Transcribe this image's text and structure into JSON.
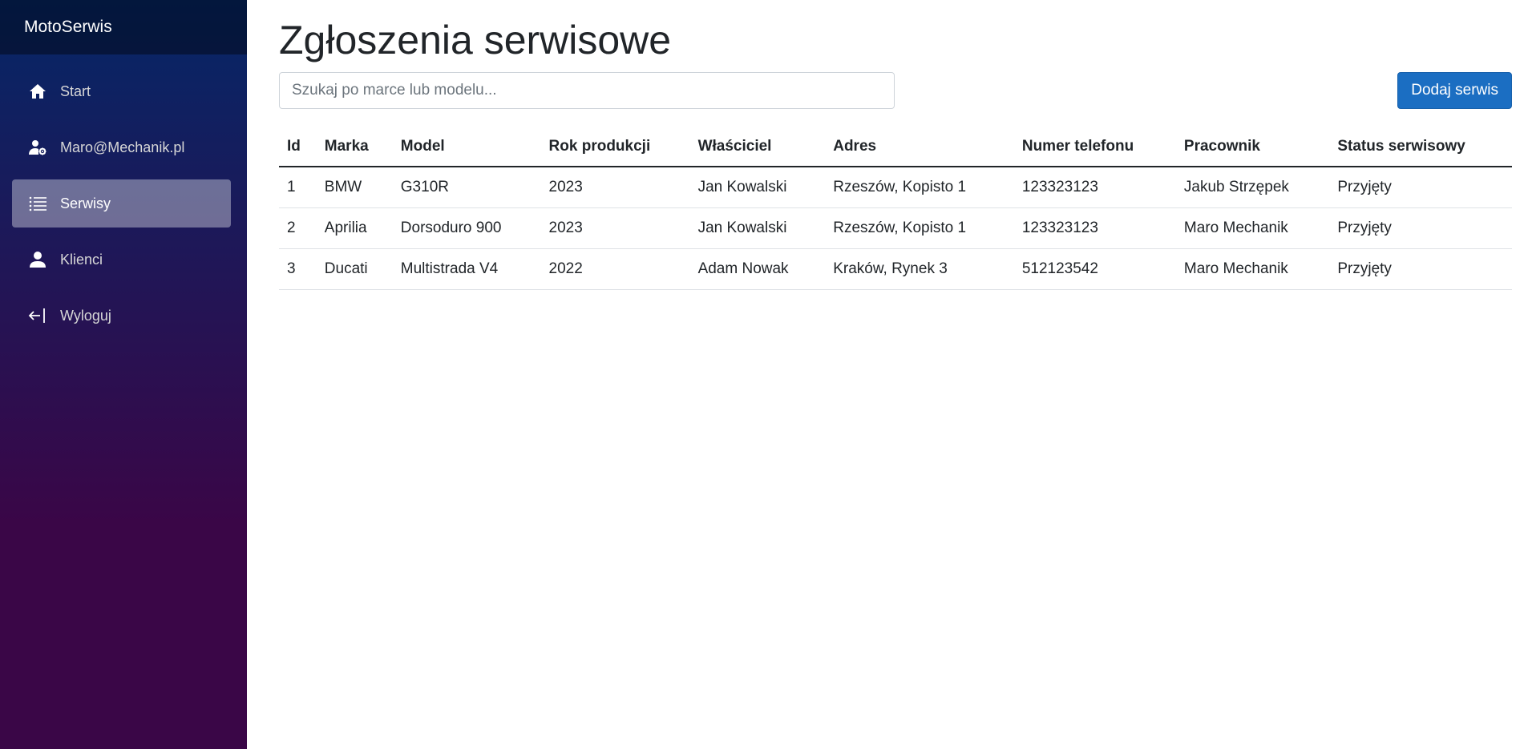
{
  "app": {
    "brand": "MotoSerwis"
  },
  "sidebar": {
    "items": [
      {
        "label": "Start",
        "icon": "home-icon",
        "active": false
      },
      {
        "label": "Maro@Mechanik.pl",
        "icon": "user-gear-icon",
        "active": false
      },
      {
        "label": "Serwisy",
        "icon": "list-icon",
        "active": true
      },
      {
        "label": "Klienci",
        "icon": "person-icon",
        "active": false
      },
      {
        "label": "Wyloguj",
        "icon": "logout-arrow-icon",
        "active": false
      }
    ]
  },
  "main": {
    "title": "Zgłoszenia serwisowe",
    "search": {
      "placeholder": "Szukaj po marce lub modelu...",
      "value": ""
    },
    "add_button": "Dodaj serwis"
  },
  "table": {
    "columns": [
      "Id",
      "Marka",
      "Model",
      "Rok produkcji",
      "Właściciel",
      "Adres",
      "Numer telefonu",
      "Pracownik",
      "Status serwisowy"
    ],
    "rows": [
      [
        "1",
        "BMW",
        "G310R",
        "2023",
        "Jan Kowalski",
        "Rzeszów, Kopisto 1",
        "123323123",
        "Jakub Strzępek",
        "Przyjęty"
      ],
      [
        "2",
        "Aprilia",
        "Dorsoduro 900",
        "2023",
        "Jan Kowalski",
        "Rzeszów, Kopisto 1",
        "123323123",
        "Maro Mechanik",
        "Przyjęty"
      ],
      [
        "3",
        "Ducati",
        "Multistrada V4",
        "2022",
        "Adam Nowak",
        "Kraków, Rynek 3",
        "512123542",
        "Maro Mechanik",
        "Przyjęty"
      ]
    ]
  },
  "colors": {
    "sidebar_top": "#052767",
    "sidebar_bottom": "#3a0647",
    "primary_button": "#1b6ec2"
  }
}
